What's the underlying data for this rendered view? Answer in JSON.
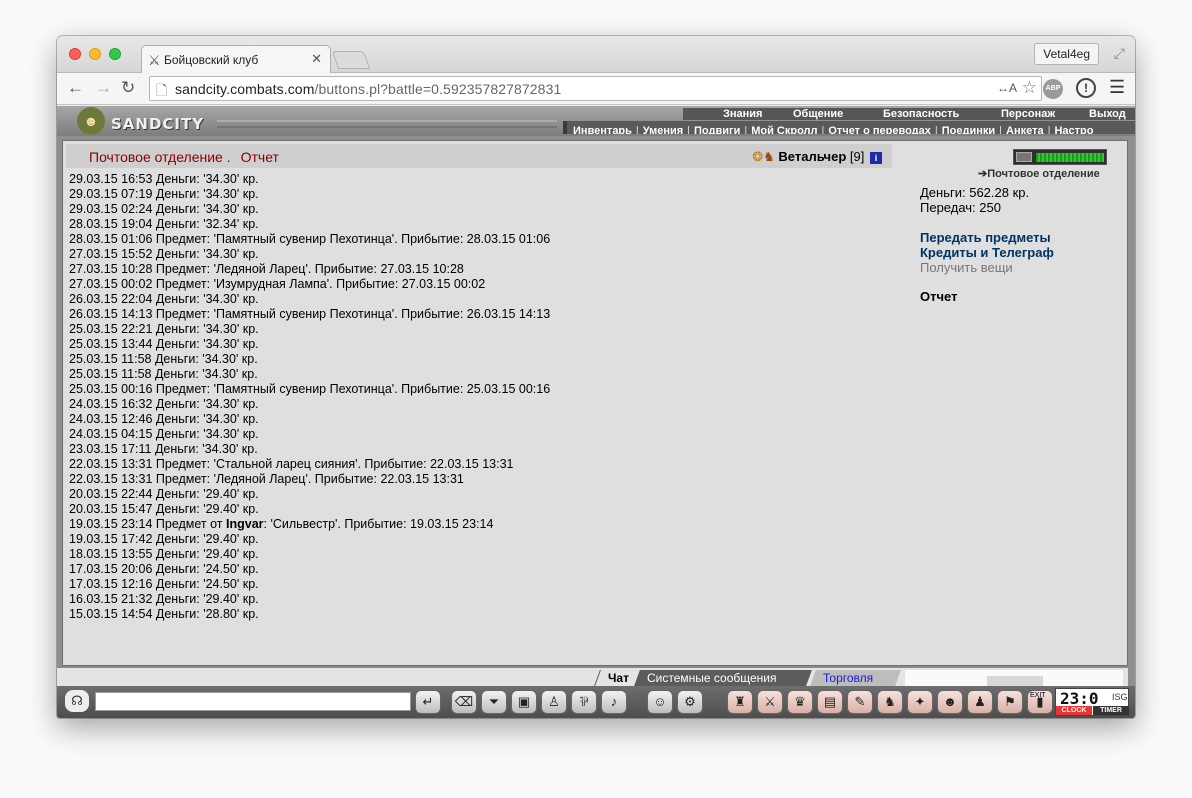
{
  "browser": {
    "tab_title": "Бойцовский клуб",
    "profile_name": "Vetal4eg",
    "url_host": "sandcity.combats.com",
    "url_path": "/buttons.pl?battle=0.592357827872831",
    "translate_label": "↔A",
    "abp_label": "ABP"
  },
  "header": {
    "brand": "SANDCITY",
    "top_menu": [
      "Знания",
      "Общение",
      "Безопасность",
      "Персонаж",
      "Выход"
    ],
    "sub_menu": [
      "Инвентарь",
      "Умения",
      "Подвиги",
      "Мой Скролл",
      "Отчет о переводах",
      "Поединки",
      "Анкета",
      "Настро"
    ]
  },
  "report": {
    "title": "Почтовое отделение .",
    "subtitle": "Отчет",
    "player_name": "Ветальчер",
    "player_level": "[9]",
    "info_badge": "i"
  },
  "log": [
    {
      "pre": "29.03.15 16:53 Деньги: '34.30' кр.",
      "who": "",
      "post": ""
    },
    {
      "pre": "29.03.15 07:19 Деньги: '34.30' кр.",
      "who": "",
      "post": ""
    },
    {
      "pre": "29.03.15 02:24 Деньги: '34.30' кр.",
      "who": "",
      "post": ""
    },
    {
      "pre": "28.03.15 19:04 Деньги: '32.34' кр.",
      "who": "",
      "post": ""
    },
    {
      "pre": "28.03.15 01:06 Предмет: 'Памятный сувенир Пехотинца'. Прибытие: 28.03.15 01:06",
      "who": "",
      "post": ""
    },
    {
      "pre": "27.03.15 15:52 Деньги: '34.30' кр.",
      "who": "",
      "post": ""
    },
    {
      "pre": "27.03.15 10:28 Предмет: 'Ледяной Ларец'. Прибытие: 27.03.15 10:28",
      "who": "",
      "post": ""
    },
    {
      "pre": "27.03.15 00:02 Предмет: 'Изумрудная Лампа'. Прибытие: 27.03.15 00:02",
      "who": "",
      "post": ""
    },
    {
      "pre": "26.03.15 22:04 Деньги: '34.30' кр.",
      "who": "",
      "post": ""
    },
    {
      "pre": "26.03.15 14:13 Предмет: 'Памятный сувенир Пехотинца'. Прибытие: 26.03.15 14:13",
      "who": "",
      "post": ""
    },
    {
      "pre": "25.03.15 22:21 Деньги: '34.30' кр.",
      "who": "",
      "post": ""
    },
    {
      "pre": "25.03.15 13:44 Деньги: '34.30' кр.",
      "who": "",
      "post": ""
    },
    {
      "pre": "25.03.15 11:58 Деньги: '34.30' кр.",
      "who": "",
      "post": ""
    },
    {
      "pre": "25.03.15 11:58 Деньги: '34.30' кр.",
      "who": "",
      "post": ""
    },
    {
      "pre": "25.03.15 00:16 Предмет: 'Памятный сувенир Пехотинца'. Прибытие: 25.03.15 00:16",
      "who": "",
      "post": ""
    },
    {
      "pre": "24.03.15 16:32 Деньги: '34.30' кр.",
      "who": "",
      "post": ""
    },
    {
      "pre": "24.03.15 12:46 Деньги: '34.30' кр.",
      "who": "",
      "post": ""
    },
    {
      "pre": "24.03.15 04:15 Деньги: '34.30' кр.",
      "who": "",
      "post": ""
    },
    {
      "pre": "23.03.15 17:11 Деньги: '34.30' кр.",
      "who": "",
      "post": ""
    },
    {
      "pre": "22.03.15 13:31 Предмет: 'Стальной ларец сияния'. Прибытие: 22.03.15 13:31",
      "who": "",
      "post": ""
    },
    {
      "pre": "22.03.15 13:31 Предмет: 'Ледяной Ларец'. Прибытие: 22.03.15 13:31",
      "who": "",
      "post": ""
    },
    {
      "pre": "20.03.15 22:44 Деньги: '29.40' кр.",
      "who": "",
      "post": ""
    },
    {
      "pre": "20.03.15 15:47 Деньги: '29.40' кр.",
      "who": "",
      "post": ""
    },
    {
      "pre": "19.03.15 23:14 Предмет от ",
      "who": "Ingvar",
      "post": ": 'Сильвестр'. Прибытие: 19.03.15 23:14"
    },
    {
      "pre": "19.03.15 17:42 Деньги: '29.40' кр.",
      "who": "",
      "post": ""
    },
    {
      "pre": "18.03.15 13:55 Деньги: '29.40' кр.",
      "who": "",
      "post": ""
    },
    {
      "pre": "17.03.15 20:06 Деньги: '24.50' кр.",
      "who": "",
      "post": ""
    },
    {
      "pre": "17.03.15 12:16 Деньги: '24.50' кр.",
      "who": "",
      "post": ""
    },
    {
      "pre": "16.03.15 21:32 Деньги: '29.40' кр.",
      "who": "",
      "post": ""
    },
    {
      "pre": "15.03.15 14:54 Деньги: '28.80' кр.",
      "who": "",
      "post": ""
    }
  ],
  "sidebar": {
    "post_office_link": "Почтовое отделение",
    "money": "Деньги: 562.28 кр.",
    "transfers": "Передач: 250",
    "links": [
      "Передать предметы",
      "Кредиты и Телеграф",
      "Получить вещи"
    ],
    "current": "Отчет"
  },
  "chat": {
    "tabs": [
      "Чат",
      "Системные сообщения",
      "Торговля"
    ],
    "input_value": ""
  },
  "clock": {
    "time": "23:0",
    "sec_label": "ISG",
    "clock_label": "CLOCK",
    "timer_label": "TIMER",
    "exit_label": "EXIT"
  },
  "colors": {
    "title_red": "#8b0000",
    "link_blue": "#003366",
    "trade_blue": "#1a1ad6"
  }
}
